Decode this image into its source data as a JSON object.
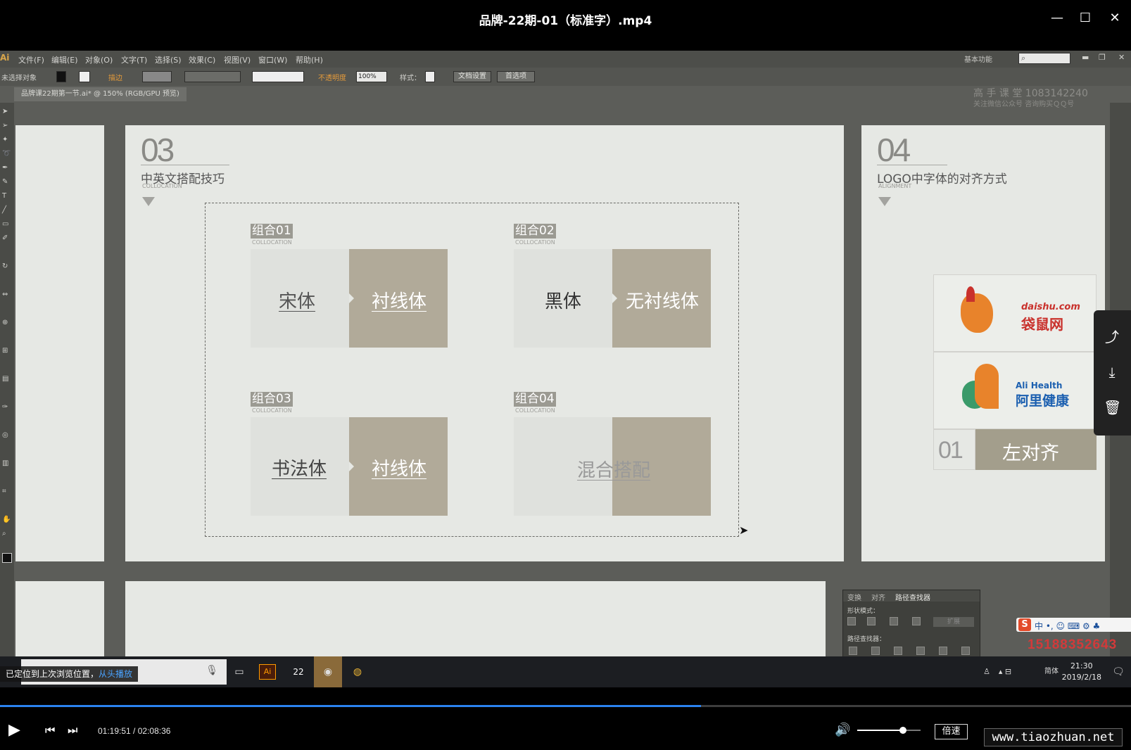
{
  "player": {
    "title": "品牌-22期-01（标准字）.mp4",
    "controls": {
      "minimize": "—",
      "maximize": "☐",
      "close": "✕"
    },
    "current_time": "01:19:51",
    "separator": " / ",
    "duration": "02:08:36",
    "progress": 0.62,
    "volume": 0.72,
    "speed_label": "倍速",
    "resume_tip": "已定位到上次浏览位置，",
    "resume_link": "从头播放",
    "watermark": "www.tiaozhuan.net"
  },
  "illustrator": {
    "logo": "Ai",
    "menus": [
      "文件(F)",
      "编辑(E)",
      "对象(O)",
      "文字(T)",
      "选择(S)",
      "效果(C)",
      "视图(V)",
      "窗口(W)",
      "帮助(H)"
    ],
    "workspace": "基本功能",
    "control_bar": {
      "no_selection": "未选择对象",
      "stroke_label": "描边",
      "opacity_label": "不透明度",
      "opacity_value": "100%",
      "style_label": "样式：",
      "doc_settings": "文档设置",
      "preferences": "首选项"
    },
    "doc_tab": "品牌课22期第一节.ai* @ 150% (RGB/GPU 预览)",
    "watermark_line1": "高 手 课 堂   1083142240",
    "watermark_line2": "关注微信公众号   咨询购买ＱＱ号"
  },
  "artboard_03": {
    "number": "03",
    "title": "中英文搭配技巧",
    "subtitle": "COLLOCATION",
    "combos": [
      {
        "tag": "组合01",
        "sub": "COLLOCATION",
        "left": "宋体",
        "right": "衬线体"
      },
      {
        "tag": "组合02",
        "sub": "COLLOCATION",
        "left": "黑体",
        "right": "无衬线体"
      },
      {
        "tag": "组合03",
        "sub": "COLLOCATION",
        "left": "书法体",
        "right": "衬线体"
      },
      {
        "tag": "组合04",
        "sub": "COLLOCATION",
        "center": "混合搭配"
      }
    ]
  },
  "artboard_04": {
    "number": "04",
    "title": "LOGO中字体的对齐方式",
    "subtitle": "ALIGNMENT",
    "logo1_en": "daishu.com",
    "logo1_cn": "袋鼠网",
    "logo2_en": "Ali Health",
    "logo2_cn": "阿里健康",
    "align_number": "01",
    "align_label": "左对齐"
  },
  "pathfinder": {
    "tabs": [
      "变换",
      "对齐",
      "路径查找器"
    ],
    "shape_modes": "形状模式：",
    "expand": "扩展",
    "pathfinders": "路径查找器："
  },
  "ime": {
    "badge": "S",
    "text": "中 •, ☺ ⌨ ⚙ ♣"
  },
  "phone": "15188352643",
  "taskbar": {
    "app_ai": "Ai",
    "app_22": "22",
    "lang": "简体",
    "time": "21:30",
    "date": "2019/2/18"
  }
}
